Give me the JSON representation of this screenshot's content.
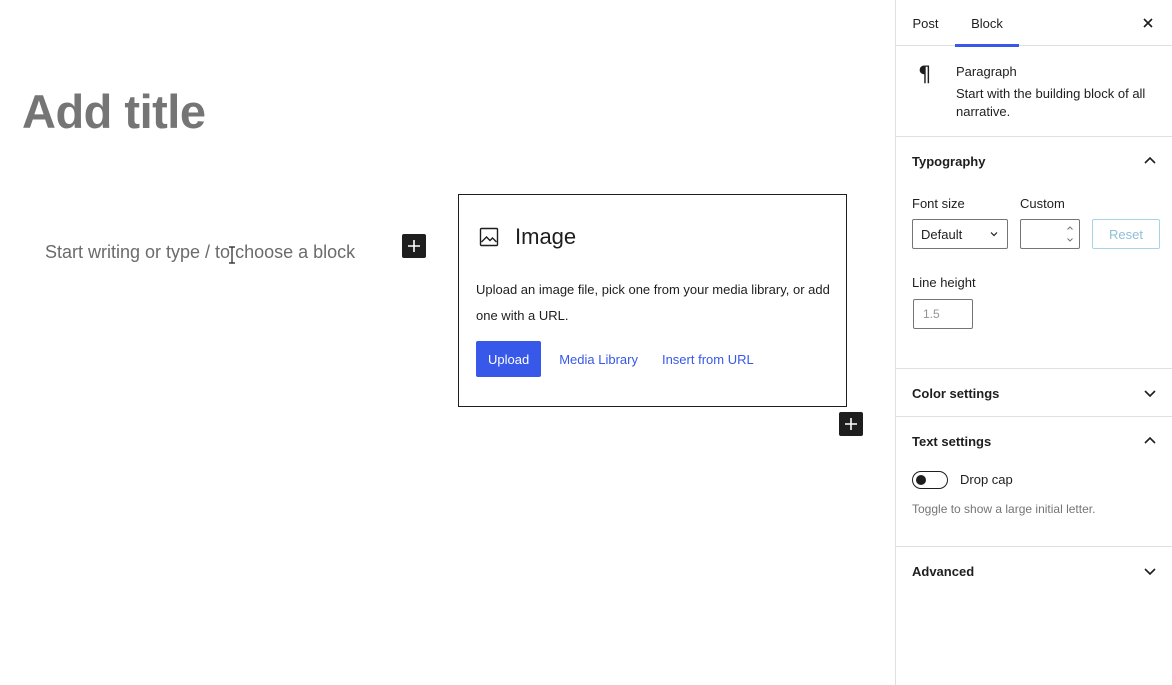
{
  "editor": {
    "title_placeholder": "Add title",
    "paragraph_placeholder": "Start writing or type / to choose a block",
    "image_block": {
      "title": "Image",
      "description": "Upload an image file, pick one from your media library, or add one with a URL.",
      "upload_label": "Upload",
      "media_library_label": "Media Library",
      "insert_url_label": "Insert from URL"
    }
  },
  "sidebar": {
    "tabs": [
      {
        "label": "Post"
      },
      {
        "label": "Block"
      }
    ],
    "active_tab": "Block",
    "block_card": {
      "title": "Paragraph",
      "description": "Start with the building block of all narrative."
    },
    "typography": {
      "title": "Typography",
      "font_size_label": "Font size",
      "font_size_value": "Default",
      "custom_label": "Custom",
      "reset_label": "Reset",
      "line_height_label": "Line height",
      "line_height_placeholder": "1.5"
    },
    "color_settings": {
      "title": "Color settings"
    },
    "text_settings": {
      "title": "Text settings",
      "drop_cap_label": "Drop cap",
      "drop_cap_help": "Toggle to show a large initial letter."
    },
    "advanced": {
      "title": "Advanced"
    }
  },
  "colors": {
    "accent": "#3858e9",
    "text": "#1e1e1e",
    "muted": "#757575",
    "border": "#e0e0e0"
  }
}
